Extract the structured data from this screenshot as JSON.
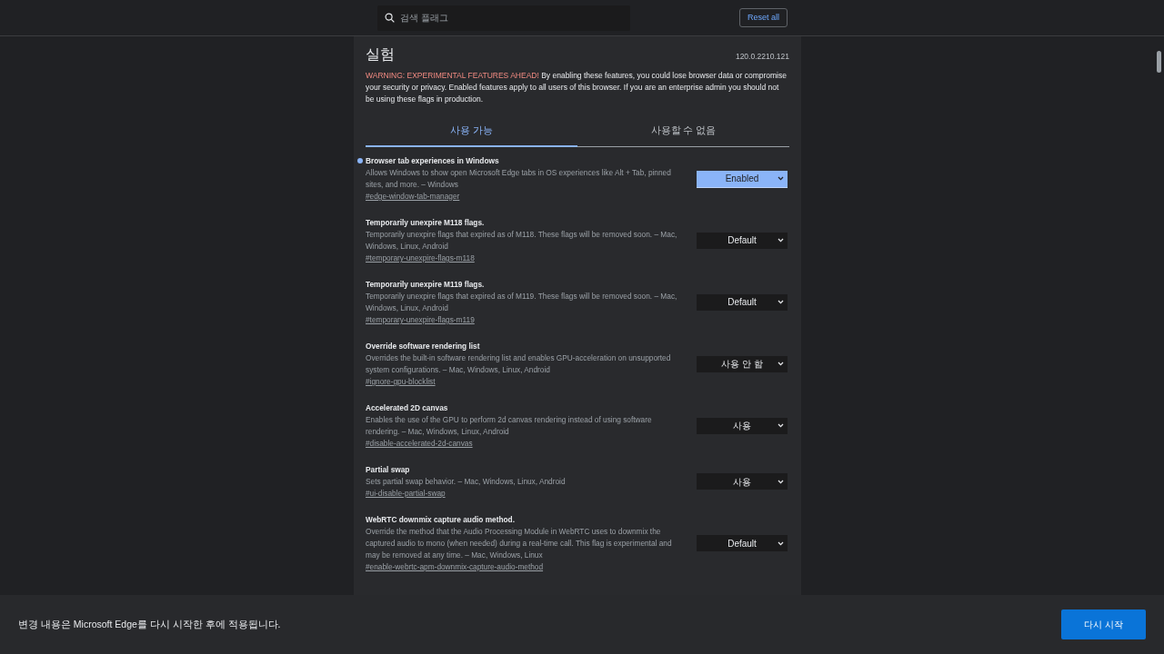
{
  "search": {
    "placeholder": "검색 플래그"
  },
  "reset_button": "Reset all",
  "title": "실험",
  "version": "120.0.2210.121",
  "warning": {
    "highlight": "WARNING: EXPERIMENTAL FEATURES AHEAD!",
    "text": "By enabling these features, you could lose browser data or compromise your security or privacy. Enabled features apply to all users of this browser. If you are an enterprise admin you should not be using these flags in production."
  },
  "tabs": [
    {
      "label": "사용 가능",
      "selected": true
    },
    {
      "label": "사용할 수 없음",
      "selected": false
    }
  ],
  "flags": [
    {
      "title": "Browser tab experiences in Windows",
      "description": "Allows Windows to show open Microsoft Edge tabs in OS experiences like Alt + Tab, pinned sites, and more. – Windows",
      "link": "#edge-window-tab-manager",
      "value": "Enabled",
      "modified": true
    },
    {
      "title": "Temporarily unexpire M118 flags.",
      "description": "Temporarily unexpire flags that expired as of M118. These flags will be removed soon. – Mac, Windows, Linux, Android",
      "link": "#temporary-unexpire-flags-m118",
      "value": "Default",
      "modified": false
    },
    {
      "title": "Temporarily unexpire M119 flags.",
      "description": "Temporarily unexpire flags that expired as of M119. These flags will be removed soon. – Mac, Windows, Linux, Android",
      "link": "#temporary-unexpire-flags-m119",
      "value": "Default",
      "modified": false
    },
    {
      "title": "Override software rendering list",
      "description": "Overrides the built-in software rendering list and enables GPU-acceleration on unsupported system configurations. – Mac, Windows, Linux, Android",
      "link": "#ignore-gpu-blocklist",
      "value": "사용 안 함",
      "modified": false
    },
    {
      "title": "Accelerated 2D canvas",
      "description": "Enables the use of the GPU to perform 2d canvas rendering instead of using software rendering. – Mac, Windows, Linux, Android",
      "link": "#disable-accelerated-2d-canvas",
      "value": "사용",
      "modified": false
    },
    {
      "title": "Partial swap",
      "description": "Sets partial swap behavior. – Mac, Windows, Linux, Android",
      "link": "#ui-disable-partial-swap",
      "value": "사용",
      "modified": false
    },
    {
      "title": "WebRTC downmix capture audio method.",
      "description": "Override the method that the Audio Processing Module in WebRTC uses to downmix the captured audio to mono (when needed) during a real-time call. This flag is experimental and may be removed at any time. – Mac, Windows, Linux",
      "link": "#enable-webrtc-apm-downmix-capture-audio-method",
      "value": "Default",
      "modified": false
    }
  ],
  "restart_bar": {
    "message": "변경 내용은 Microsoft Edge를 다시 시작한 후에 적용됩니다.",
    "button": "다시 시작"
  }
}
